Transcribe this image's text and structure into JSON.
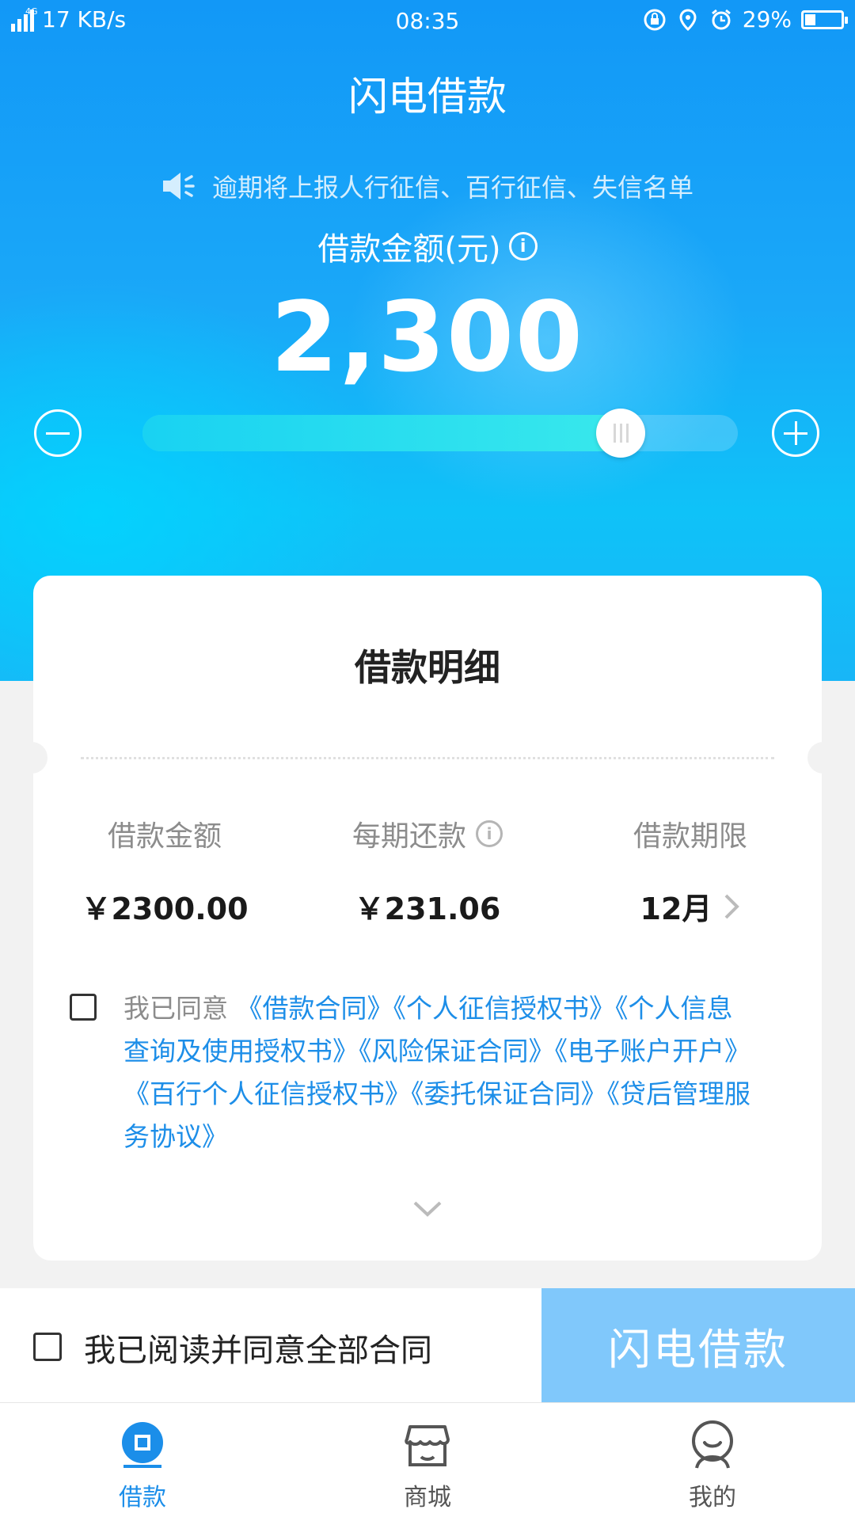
{
  "status_bar": {
    "network": "4G",
    "speed": "17 KB/s",
    "time": "08:35",
    "battery": "29%",
    "battery_level": 0.29
  },
  "app": {
    "title": "闪电借款",
    "notice": "逾期将上报人行征信、百行征信、失信名单",
    "amount_label": "借款金额(元)",
    "amount": "2,300",
    "slider_level": 0.83
  },
  "details": {
    "title": "借款明细",
    "columns": [
      {
        "label": "借款金额",
        "value": "￥2300.00"
      },
      {
        "label": "每期还款",
        "value": "￥231.06"
      },
      {
        "label": "借款期限",
        "value": "12月"
      }
    ],
    "agree_prefix": "我已同意",
    "contracts": [
      "《借款合同》",
      "《个人征信授权书》",
      "《个人信息查询及使用授权书》",
      "《风险保证合同》",
      "《电子账户开户》",
      "《百行个人征信授权书》",
      "《委托保证合同》",
      "《贷后管理服务协议》"
    ]
  },
  "action_bar": {
    "agree_all": "我已阅读并同意全部合同",
    "submit": "闪电借款"
  },
  "tabs": [
    {
      "label": "借款",
      "icon": "loan-icon",
      "active": true
    },
    {
      "label": "商城",
      "icon": "store-icon",
      "active": false
    },
    {
      "label": "我的",
      "icon": "profile-icon",
      "active": false
    }
  ],
  "colors": {
    "primary": "#1298f7",
    "link": "#1d8ee8",
    "submit_disabled": "#80c8fb"
  }
}
